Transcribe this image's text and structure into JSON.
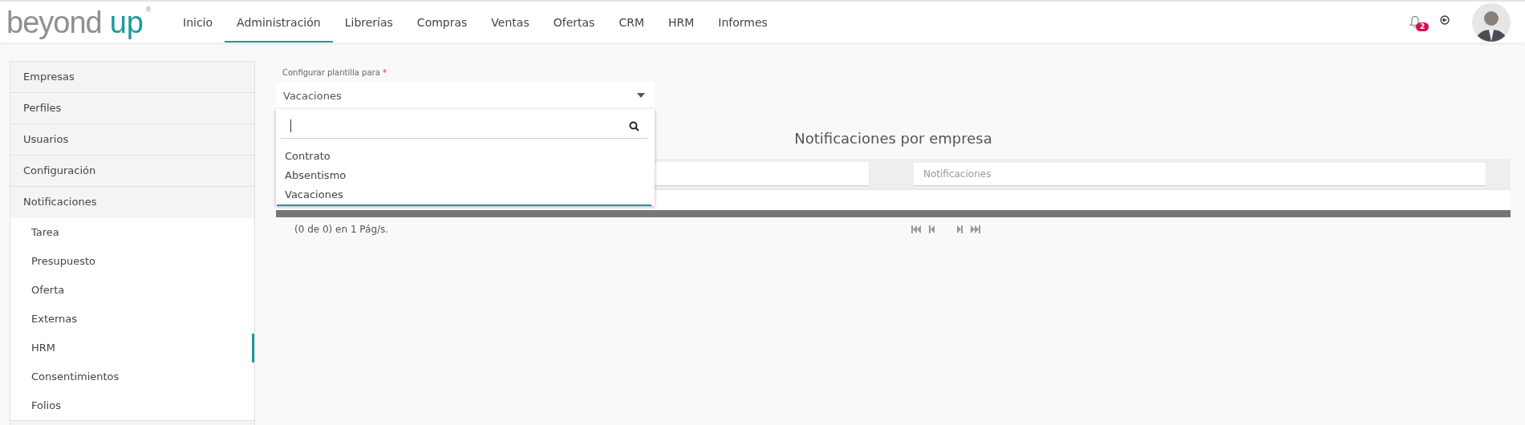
{
  "header": {
    "logo": {
      "text_main": "beyond",
      "text_accent": "up",
      "mark": "®"
    },
    "nav": [
      {
        "label": "Inicio",
        "selected": false
      },
      {
        "label": "Administración",
        "selected": true
      },
      {
        "label": "Librerías",
        "selected": false
      },
      {
        "label": "Compras",
        "selected": false
      },
      {
        "label": "Ventas",
        "selected": false
      },
      {
        "label": "Ofertas",
        "selected": false
      },
      {
        "label": "CRM",
        "selected": false
      },
      {
        "label": "HRM",
        "selected": false
      },
      {
        "label": "Informes",
        "selected": false
      }
    ],
    "notifications": {
      "count": "2"
    }
  },
  "sidebar": {
    "items": [
      {
        "label": "Empresas",
        "expanded": false
      },
      {
        "label": "Perfiles",
        "expanded": false
      },
      {
        "label": "Usuarios",
        "expanded": false
      },
      {
        "label": "Configuración",
        "expanded": false
      },
      {
        "label": "Notificaciones",
        "expanded": true,
        "children": [
          {
            "label": "Tarea",
            "selected": false
          },
          {
            "label": "Presupuesto",
            "selected": false
          },
          {
            "label": "Oferta",
            "selected": false
          },
          {
            "label": "Externas",
            "selected": false
          },
          {
            "label": "HRM",
            "selected": true
          },
          {
            "label": "Consentimientos",
            "selected": false
          },
          {
            "label": "Folios",
            "selected": false
          }
        ]
      }
    ]
  },
  "template_select": {
    "label": "Configurar plantilla para",
    "required_mark": "*",
    "value": "Vacaciones",
    "open": true,
    "options": [
      {
        "label": "Contrato",
        "selected": false
      },
      {
        "label": "Absentismo",
        "selected": false
      },
      {
        "label": "Vacaciones",
        "selected": true
      }
    ]
  },
  "table": {
    "title": "Notificaciones por empresa",
    "filters": [
      {
        "placeholder": "Notificaciones"
      }
    ],
    "pagination": {
      "summary": "(0 de 0) en 1 Pág/s."
    }
  }
}
